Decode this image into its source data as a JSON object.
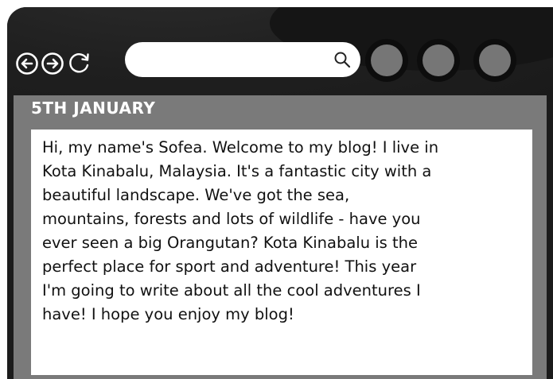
{
  "browser": {
    "nav": {
      "back_icon": "circle-arrow-left-icon",
      "forward_icon": "circle-arrow-right-icon",
      "reload_icon": "reload-icon"
    },
    "search": {
      "value": "",
      "icon": "search-icon"
    },
    "window_buttons": [
      "circle-button",
      "circle-button",
      "circle-button"
    ]
  },
  "post": {
    "date": "5TH JANUARY",
    "body": "Hi, my name's Sofea. Welcome to my blog! I live in\nKota Kinabalu, Malaysia. It's a fantastic city with a\nbeautiful landscape. We've got the sea,\nmountains, forests and lots of wildlife - have you\never seen a big Orangutan? Kota Kinabalu is the\nperfect place for sport and adventure! This year\nI'm going to write about all the cool adventures I\nhave! I hope you enjoy my blog!"
  },
  "colors": {
    "frame": "#1b1b1b",
    "content_bg": "#7a7a7a",
    "post_bg": "#ffffff",
    "circle_button": "#767676"
  }
}
